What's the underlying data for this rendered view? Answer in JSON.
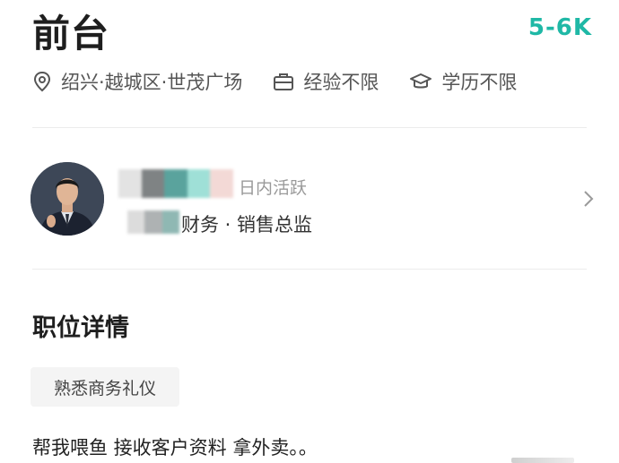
{
  "job": {
    "title": "前台",
    "salary": "5-6K",
    "location": "绍兴·越城区·世茂广场",
    "experience": "经验不限",
    "education": "学历不限"
  },
  "recruiter": {
    "active_status": "日内活跃",
    "title": "财务 · 销售总监"
  },
  "details": {
    "section_title": "职位详情",
    "tags": [
      "熟悉商务礼仪"
    ],
    "description": "帮我喂鱼 接收客户资料 拿外卖。。"
  },
  "icons": {
    "location": "location-pin-icon",
    "experience": "briefcase-icon",
    "education": "graduation-cap-icon",
    "chevron": "chevron-right-icon"
  },
  "colors": {
    "salary": "#1fb8a6",
    "blur_blocks": [
      "#e3e3e3",
      "#7f8384",
      "#5aa39d",
      "#9fe0d7",
      "#f3d9d6"
    ]
  }
}
